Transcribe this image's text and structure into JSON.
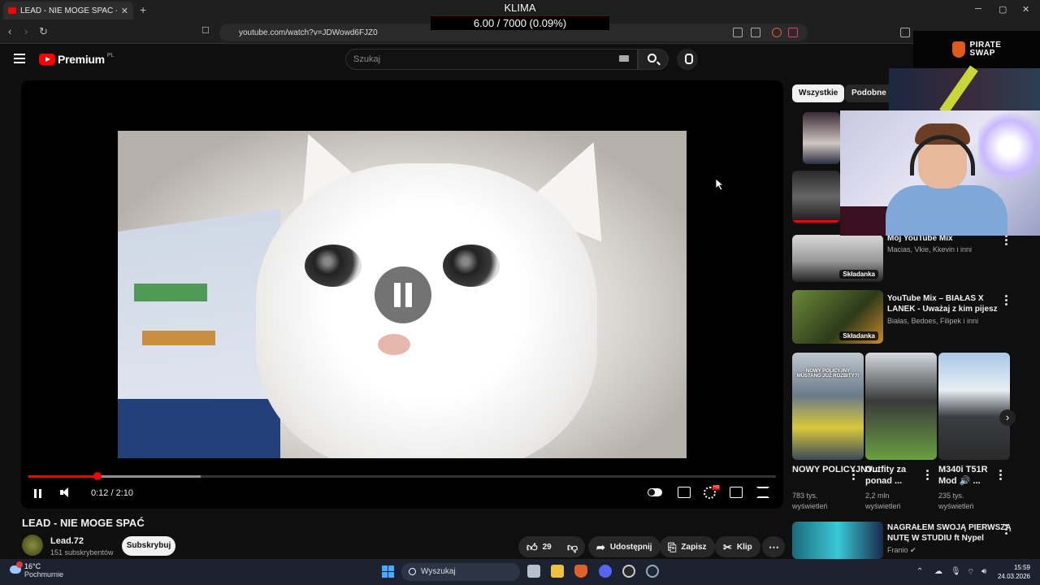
{
  "browser": {
    "tab_title": "LEAD - NIE MOGE SPAĆ - You",
    "tab_close": "✕",
    "new_tab": "+",
    "url": "youtube.com/watch?v=JDWowd6FJZ0",
    "win_min": "─",
    "win_max": "▢",
    "win_close": "✕"
  },
  "overlay": {
    "klima_title": "KLIMA",
    "klima_value": "6.00 / 7000 (0.09%)",
    "sponsor_line1": "PIRATE",
    "sponsor_line2": "SWAP"
  },
  "youtube": {
    "logo_text": "Premium",
    "logo_region": "PL",
    "search_placeholder": "Szukaj"
  },
  "player": {
    "time": "0:12 / 2:10",
    "played_fraction": 0.0923,
    "buffered_fraction": 0.23
  },
  "video": {
    "title": "LEAD - NIE MOGE SPAĆ",
    "channel": "Lead.72",
    "subscribers": "151 subskrybentów",
    "subscribe_label": "Subskrybuj",
    "likes": "29",
    "share_label": "Udostępnij",
    "save_label": "Zapisz",
    "clip_label": "Klip"
  },
  "sidebar": {
    "chips": [
      "Wszystkie",
      "Podobne"
    ],
    "mix1": {
      "title": "Mój YouTube Mix",
      "meta": "Macias, Vkie, Kkevin i inni",
      "badge": "Składanka"
    },
    "mix2": {
      "title_line1": "YouTube Mix – BIAŁAS X",
      "title_line2": "LANEK - Uważaj z kim pijesz",
      "meta": "Białas, Bedoes, Filipek i inni",
      "badge": "Składanka"
    },
    "shorts": [
      {
        "title": "NOWY POLICYJNY...",
        "views1": "783 tys.",
        "views2": "wyświetleń"
      },
      {
        "title_line1": "Outfity za",
        "title_line2": "ponad ...",
        "views1": "2,2 mln",
        "views2": "wyświetleń"
      },
      {
        "title_line1": "M340i T51R",
        "title_line2": "Mod 🔊 ...",
        "views1": "235 tys.",
        "views2": "wyświetleń"
      }
    ],
    "short_overlay_text": "NOWY POLICYJNY MUSTANG JUŻ ROZBITY?!",
    "last": {
      "title_line1": "NAGRAŁEM SWOJĄ PIERWSZĄ",
      "title_line2": "NUTĘ W STUDIU ft Nypel",
      "channel": "Franio ✔"
    }
  },
  "taskbar": {
    "temp": "16°C",
    "weather": "Pochmurnie",
    "search_label": "Wyszukaj",
    "time": "15:59",
    "date": "24.03.2026"
  },
  "colors": {
    "accent": "#ff0000",
    "background": "#0f0f0f",
    "chip_active": "#f1f1f1"
  }
}
